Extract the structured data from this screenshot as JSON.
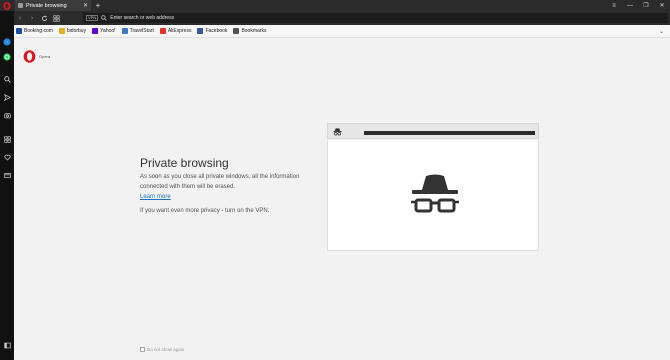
{
  "tab": {
    "title": "Private browsing"
  },
  "address": {
    "placeholder": "Enter search or web address",
    "vpn_badge": "VPN"
  },
  "bookmarks": [
    {
      "label": "Booking.com",
      "icon": "booking-icon",
      "color": "#1a4ea8"
    },
    {
      "label": "bidorbuy",
      "icon": "bidorbuy-icon",
      "color": "#e0b020"
    },
    {
      "label": "Yahoo!",
      "icon": "yahoo-icon",
      "color": "#5f01d1"
    },
    {
      "label": "TravelStart",
      "icon": "travelstart-icon",
      "color": "#3a78c8"
    },
    {
      "label": "AliExpress",
      "icon": "aliexpress-icon",
      "color": "#e43225"
    },
    {
      "label": "Facebook",
      "icon": "facebook-icon",
      "color": "#3b5998"
    },
    {
      "label": "Bookmarks",
      "icon": "bookmarks-folder-icon",
      "color": "#555555"
    }
  ],
  "brand": {
    "name": "Opera",
    "color": "#e0141e"
  },
  "main": {
    "heading": "Private browsing",
    "description": "As soon as you close all private windows, all the information connected with them will be erased.",
    "learn_more": "Learn more",
    "vpn_text": "If you want even more privacy - turn on the VPN.",
    "dont_show": "Do not show again"
  }
}
